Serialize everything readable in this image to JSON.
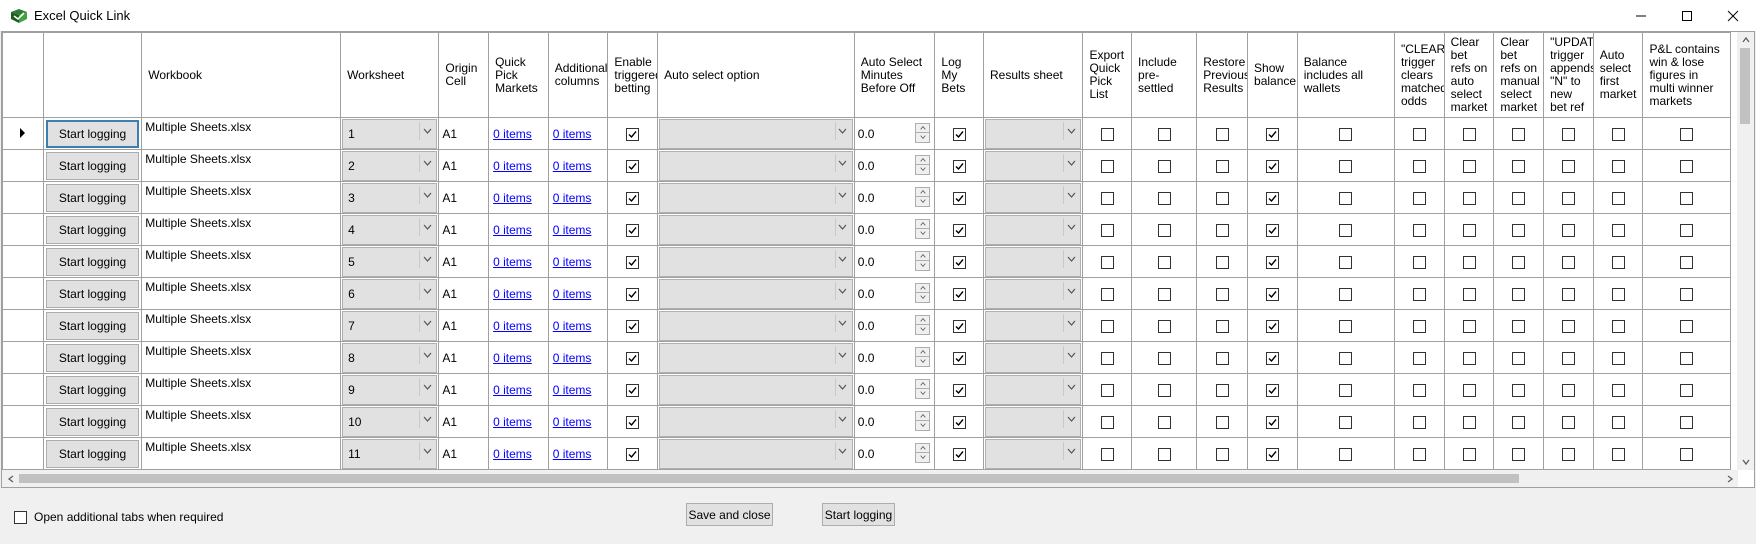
{
  "window": {
    "title": "Excel Quick Link"
  },
  "columns": [
    "",
    "",
    "Workbook",
    "Worksheet",
    "Origin Cell",
    "Quick Pick Markets",
    "Additional columns",
    "Enable triggered betting",
    "Auto select option",
    "Auto Select Minutes Before Off",
    "Log My Bets",
    "Results sheet",
    "Export Quick Pick List",
    "Include pre-settled",
    "Restore Previous Results",
    "Show balance",
    "Balance includes all wallets",
    "\"CLEAR trigger clears matched odds",
    "Clear bet refs on auto select market",
    "Clear bet refs on manual select market",
    "\"UPDATE trigger appends \"N\" to new bet ref",
    "Auto select first market",
    "P&L contains win & lose figures in multi winner markets"
  ],
  "rows": [
    {
      "button": "Start logging",
      "workbook": "Multiple Sheets.xlsx",
      "worksheet": "1",
      "origin": "A1",
      "quick_pick": "0 items",
      "additional": "0 items",
      "triggered": true,
      "auto_select": "",
      "minutes": "0.0",
      "log_bets": true,
      "results_sheet": "",
      "export_qp": false,
      "pre_settled": false,
      "restore": false,
      "show_balance": true,
      "all_wallets": false,
      "clear_trigger": false,
      "clear_auto": false,
      "clear_manual": false,
      "update_trigger": false,
      "auto_first": false,
      "pl_multi": false
    },
    {
      "button": "Start logging",
      "workbook": "Multiple Sheets.xlsx",
      "worksheet": "2",
      "origin": "A1",
      "quick_pick": "0 items",
      "additional": "0 items",
      "triggered": true,
      "auto_select": "",
      "minutes": "0.0",
      "log_bets": true,
      "results_sheet": "",
      "export_qp": false,
      "pre_settled": false,
      "restore": false,
      "show_balance": true,
      "all_wallets": false,
      "clear_trigger": false,
      "clear_auto": false,
      "clear_manual": false,
      "update_trigger": false,
      "auto_first": false,
      "pl_multi": false
    },
    {
      "button": "Start logging",
      "workbook": "Multiple Sheets.xlsx",
      "worksheet": "3",
      "origin": "A1",
      "quick_pick": "0 items",
      "additional": "0 items",
      "triggered": true,
      "auto_select": "",
      "minutes": "0.0",
      "log_bets": true,
      "results_sheet": "",
      "export_qp": false,
      "pre_settled": false,
      "restore": false,
      "show_balance": true,
      "all_wallets": false,
      "clear_trigger": false,
      "clear_auto": false,
      "clear_manual": false,
      "update_trigger": false,
      "auto_first": false,
      "pl_multi": false
    },
    {
      "button": "Start logging",
      "workbook": "Multiple Sheets.xlsx",
      "worksheet": "4",
      "origin": "A1",
      "quick_pick": "0 items",
      "additional": "0 items",
      "triggered": true,
      "auto_select": "",
      "minutes": "0.0",
      "log_bets": true,
      "results_sheet": "",
      "export_qp": false,
      "pre_settled": false,
      "restore": false,
      "show_balance": true,
      "all_wallets": false,
      "clear_trigger": false,
      "clear_auto": false,
      "clear_manual": false,
      "update_trigger": false,
      "auto_first": false,
      "pl_multi": false
    },
    {
      "button": "Start logging",
      "workbook": "Multiple Sheets.xlsx",
      "worksheet": "5",
      "origin": "A1",
      "quick_pick": "0 items",
      "additional": "0 items",
      "triggered": true,
      "auto_select": "",
      "minutes": "0.0",
      "log_bets": true,
      "results_sheet": "",
      "export_qp": false,
      "pre_settled": false,
      "restore": false,
      "show_balance": true,
      "all_wallets": false,
      "clear_trigger": false,
      "clear_auto": false,
      "clear_manual": false,
      "update_trigger": false,
      "auto_first": false,
      "pl_multi": false
    },
    {
      "button": "Start logging",
      "workbook": "Multiple Sheets.xlsx",
      "worksheet": "6",
      "origin": "A1",
      "quick_pick": "0 items",
      "additional": "0 items",
      "triggered": true,
      "auto_select": "",
      "minutes": "0.0",
      "log_bets": true,
      "results_sheet": "",
      "export_qp": false,
      "pre_settled": false,
      "restore": false,
      "show_balance": true,
      "all_wallets": false,
      "clear_trigger": false,
      "clear_auto": false,
      "clear_manual": false,
      "update_trigger": false,
      "auto_first": false,
      "pl_multi": false
    },
    {
      "button": "Start logging",
      "workbook": "Multiple Sheets.xlsx",
      "worksheet": "7",
      "origin": "A1",
      "quick_pick": "0 items",
      "additional": "0 items",
      "triggered": true,
      "auto_select": "",
      "minutes": "0.0",
      "log_bets": true,
      "results_sheet": "",
      "export_qp": false,
      "pre_settled": false,
      "restore": false,
      "show_balance": true,
      "all_wallets": false,
      "clear_trigger": false,
      "clear_auto": false,
      "clear_manual": false,
      "update_trigger": false,
      "auto_first": false,
      "pl_multi": false
    },
    {
      "button": "Start logging",
      "workbook": "Multiple Sheets.xlsx",
      "worksheet": "8",
      "origin": "A1",
      "quick_pick": "0 items",
      "additional": "0 items",
      "triggered": true,
      "auto_select": "",
      "minutes": "0.0",
      "log_bets": true,
      "results_sheet": "",
      "export_qp": false,
      "pre_settled": false,
      "restore": false,
      "show_balance": true,
      "all_wallets": false,
      "clear_trigger": false,
      "clear_auto": false,
      "clear_manual": false,
      "update_trigger": false,
      "auto_first": false,
      "pl_multi": false
    },
    {
      "button": "Start logging",
      "workbook": "Multiple Sheets.xlsx",
      "worksheet": "9",
      "origin": "A1",
      "quick_pick": "0 items",
      "additional": "0 items",
      "triggered": true,
      "auto_select": "",
      "minutes": "0.0",
      "log_bets": true,
      "results_sheet": "",
      "export_qp": false,
      "pre_settled": false,
      "restore": false,
      "show_balance": true,
      "all_wallets": false,
      "clear_trigger": false,
      "clear_auto": false,
      "clear_manual": false,
      "update_trigger": false,
      "auto_first": false,
      "pl_multi": false
    },
    {
      "button": "Start logging",
      "workbook": "Multiple Sheets.xlsx",
      "worksheet": "10",
      "origin": "A1",
      "quick_pick": "0 items",
      "additional": "0 items",
      "triggered": true,
      "auto_select": "",
      "minutes": "0.0",
      "log_bets": true,
      "results_sheet": "",
      "export_qp": false,
      "pre_settled": false,
      "restore": false,
      "show_balance": true,
      "all_wallets": false,
      "clear_trigger": false,
      "clear_auto": false,
      "clear_manual": false,
      "update_trigger": false,
      "auto_first": false,
      "pl_multi": false
    },
    {
      "button": "Start logging",
      "workbook": "Multiple Sheets.xlsx",
      "worksheet": "11",
      "origin": "A1",
      "quick_pick": "0 items",
      "additional": "0 items",
      "triggered": true,
      "auto_select": "",
      "minutes": "0.0",
      "log_bets": true,
      "results_sheet": "",
      "export_qp": false,
      "pre_settled": false,
      "restore": false,
      "show_balance": true,
      "all_wallets": false,
      "clear_trigger": false,
      "clear_auto": false,
      "clear_manual": false,
      "update_trigger": false,
      "auto_first": false,
      "pl_multi": false
    }
  ],
  "footer": {
    "open_tabs_label": "Open additional tabs when required",
    "open_tabs_checked": false,
    "save_close_label": "Save and close",
    "start_logging_label": "Start logging"
  },
  "colors": {
    "link": "#0000ff",
    "button_face": "#e1e1e1",
    "focus_border": "#3c7fb1"
  }
}
